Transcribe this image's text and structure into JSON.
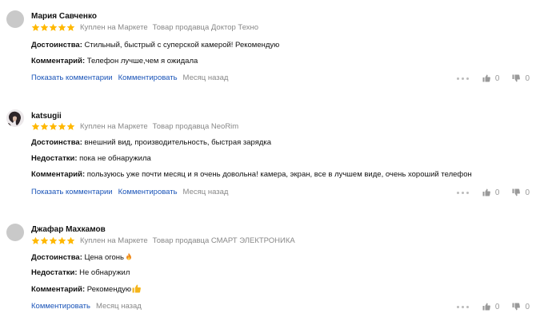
{
  "reviews": [
    {
      "author": "Мария Савченко",
      "rating": 5,
      "bought": "Куплен на Маркете",
      "seller": "Товар продавца Доктор Техно",
      "fields": [
        {
          "label": "Достоинства:",
          "value": "Стильный, быстрый с суперской камерой! Рекомендую"
        },
        {
          "label": "Комментарий:",
          "value": "Телефон лучше,чем я ожидала"
        }
      ],
      "show_comments": "Показать комментарии",
      "comment": "Комментировать",
      "date": "Месяц назад",
      "likes": "0",
      "dislikes": "0"
    },
    {
      "author": "katsugii",
      "rating": 5,
      "bought": "Куплен на Маркете",
      "seller": "Товар продавца NeoRim",
      "fields": [
        {
          "label": "Достоинства:",
          "value": "внешний вид, производительность, быстрая зарядка"
        },
        {
          "label": "Недостатки:",
          "value": "пока не обнаружила"
        },
        {
          "label": "Комментарий:",
          "value": "пользуюсь уже почти месяц и я очень довольна! камера, экран, все в лучшем виде, очень хороший телефон"
        }
      ],
      "show_comments": "Показать комментарии",
      "comment": "Комментировать",
      "date": "Месяц назад",
      "likes": "0",
      "dislikes": "0"
    },
    {
      "author": "Джафар Махкамов",
      "rating": 5,
      "bought": "Куплен на Маркете",
      "seller": "Товар продавца СМАРТ ЭЛЕКТРОНИКА",
      "fields": [
        {
          "label": "Достоинства:",
          "value": "Цена огонь",
          "emoji": "fire-emoji"
        },
        {
          "label": "Недостатки:",
          "value": "Не обнаружил"
        },
        {
          "label": "Комментарий:",
          "value": "Рекомендую",
          "emoji": "thumbs-up-emoji"
        }
      ],
      "comment": "Комментировать",
      "date": "Месяц назад",
      "likes": "0",
      "dislikes": "0"
    }
  ],
  "colors": {
    "star": "#ffb800",
    "link": "#1a54b8",
    "muted": "#888888"
  }
}
